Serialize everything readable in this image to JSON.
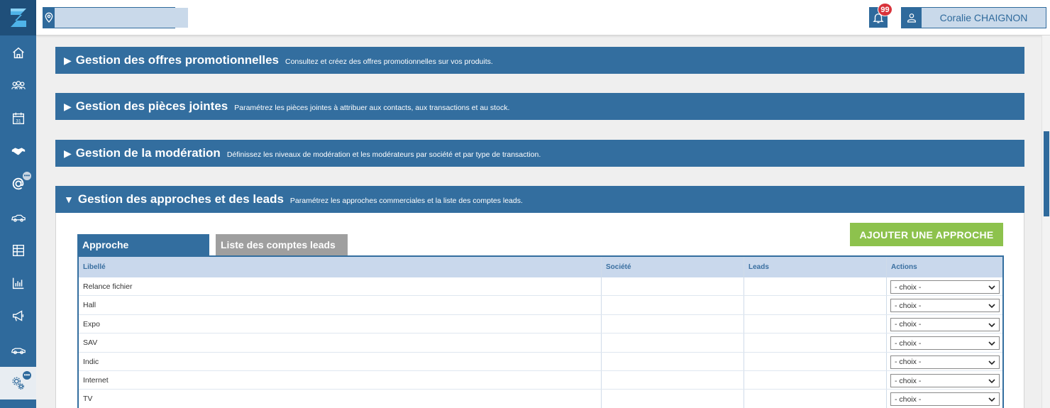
{
  "topbar": {
    "location_placeholder": "",
    "notifications_count": "99",
    "user_name": "Coralie CHAIGNON"
  },
  "sidebar": {
    "items": [
      {
        "icon": "home-icon"
      },
      {
        "icon": "contacts-icon"
      },
      {
        "icon": "calendar-icon"
      },
      {
        "icon": "handshake-icon"
      },
      {
        "icon": "at-sign-icon",
        "badge": "•••"
      },
      {
        "icon": "vehicles-icon"
      },
      {
        "icon": "table-icon"
      },
      {
        "icon": "chart-icon"
      },
      {
        "icon": "megaphone-icon"
      },
      {
        "icon": "car-icon"
      },
      {
        "icon": "settings-gears-icon",
        "badge": "•••",
        "active": true
      }
    ]
  },
  "sections": [
    {
      "title": "Gestion des offres promotionnelles",
      "desc": "Consultez et créez des offres promotionnelles sur vos produits.",
      "expanded": false
    },
    {
      "title": "Gestion des pièces jointes",
      "desc": "Paramétrez les pièces jointes à attribuer aux contacts, aux transactions et au stock.",
      "expanded": false
    },
    {
      "title": "Gestion de la modération",
      "desc": "Définissez les niveaux de modération et les modérateurs par société et par type de transaction.",
      "expanded": false
    },
    {
      "title": "Gestion des approches et des leads",
      "desc": "Paramétrez les approches commerciales et la liste des comptes leads.",
      "expanded": true
    }
  ],
  "panel": {
    "add_button": "AJOUTER UNE APPROCHE",
    "tabs": [
      "Approche",
      "Liste des comptes leads"
    ],
    "columns": [
      "Libellé",
      "Société",
      "Leads",
      "Actions"
    ],
    "rows": [
      {
        "libelle": "Relance fichier",
        "societe": "",
        "leads": "",
        "action": "- choix -"
      },
      {
        "libelle": "Hall",
        "societe": "",
        "leads": "",
        "action": "- choix -"
      },
      {
        "libelle": "Expo",
        "societe": "",
        "leads": "",
        "action": "- choix -"
      },
      {
        "libelle": "SAV",
        "societe": "",
        "leads": "",
        "action": "- choix -"
      },
      {
        "libelle": "Indic",
        "societe": "",
        "leads": "",
        "action": "- choix -"
      },
      {
        "libelle": "Internet",
        "societe": "",
        "leads": "",
        "action": "- choix -"
      },
      {
        "libelle": "TV",
        "societe": "",
        "leads": "",
        "action": "- choix -"
      }
    ]
  },
  "colors": {
    "primary": "#336e9f",
    "accent_green": "#8dc24d",
    "badge_red": "#d9333b"
  }
}
